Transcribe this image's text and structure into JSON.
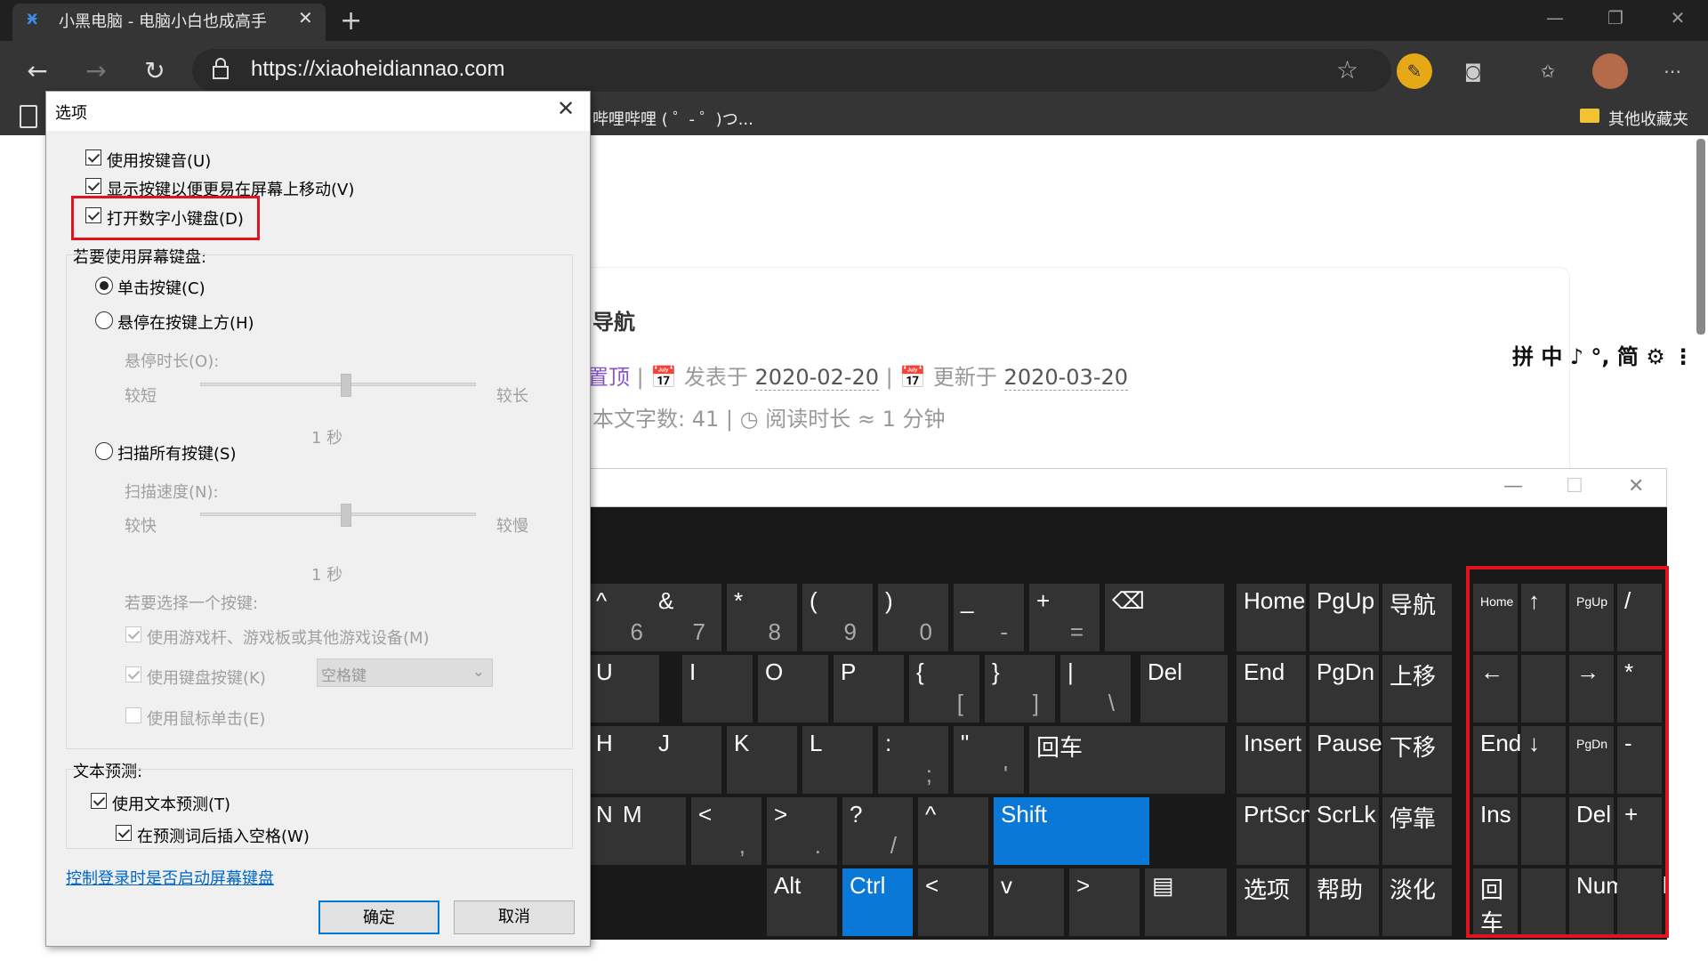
{
  "browser": {
    "tab_title": "小黑电脑 - 电脑小白也成高手",
    "url": "https://xiaoheidiannao.com",
    "bookmark_item": "哔哩哔哩 ( ゜- ゜)つ...",
    "bookmark_other": "其他收藏夹"
  },
  "page": {
    "post_title": "导航",
    "meta_pin": "置顶",
    "meta_published_label": "发表于",
    "meta_published": "2020-02-20",
    "meta_updated_label": "更新于",
    "meta_updated": "2020-03-20",
    "word_count_label": "本文字数:",
    "word_count": "41",
    "read_time": "阅读时长 ≈ 1 分钟",
    "ime_bar": "拼 中 ♪ °, 简 ⚙ ⋮"
  },
  "dialog": {
    "title": "选项",
    "opt_sound": "使用按键音(U)",
    "opt_show_keys": "显示按键以便更易在屏幕上移动(V)",
    "opt_numpad": "打开数字小键盘(D)",
    "use_keyboard_label": "若要使用屏幕键盘:",
    "radio_click": "单击按键(C)",
    "radio_hover": "悬停在按键上方(H)",
    "hover_duration": "悬停时长(O):",
    "short": "较短",
    "long": "较长",
    "one_sec_1": "1 秒",
    "radio_scan": "扫描所有按键(S)",
    "scan_speed": "扫描速度(N):",
    "fast": "较快",
    "slow": "较慢",
    "one_sec_2": "1 秒",
    "select_key_label": "若要选择一个按键:",
    "opt_joystick": "使用游戏杆、游戏板或其他游戏设备(M)",
    "opt_keyboard_key": "使用键盘按键(K)",
    "key_select": "空格键",
    "opt_mouse": "使用鼠标单击(E)",
    "text_predict_label": "文本预测:",
    "opt_text_predict": "使用文本预测(T)",
    "opt_insert_space": "在预测词后插入空格(W)",
    "control_link": "控制登录时是否启动屏幕键盘",
    "ok": "确定",
    "cancel": "取消"
  },
  "osk": {
    "row1": [
      [
        "^",
        "6"
      ],
      [
        "&",
        "7"
      ],
      [
        "*",
        "8"
      ],
      [
        "(",
        "9"
      ],
      [
        ")",
        "0"
      ],
      [
        "_",
        "-"
      ],
      [
        "+",
        "="
      ],
      [
        "⌫",
        ""
      ]
    ],
    "row2": [
      [
        "U",
        ""
      ],
      [
        "I",
        ""
      ],
      [
        "O",
        ""
      ],
      [
        "P",
        ""
      ],
      [
        "{",
        "["
      ],
      [
        "}",
        "]"
      ],
      [
        "|",
        "\\"
      ],
      [
        "Del",
        ""
      ]
    ],
    "row3": [
      [
        "H",
        ""
      ],
      [
        "J",
        ""
      ],
      [
        "K",
        ""
      ],
      [
        "L",
        ""
      ],
      [
        ":",
        ";"
      ],
      [
        "\"",
        "'"
      ],
      [
        "回车",
        ""
      ]
    ],
    "row4": [
      [
        "N",
        ""
      ],
      [
        "M",
        ""
      ],
      [
        "<",
        ","
      ],
      [
        ">",
        "."
      ],
      [
        "?",
        "/"
      ],
      [
        "^",
        ""
      ],
      [
        "Shift",
        ""
      ]
    ],
    "row5": [
      [
        "Alt",
        ""
      ],
      [
        "Ctrl",
        ""
      ],
      [
        "<",
        ""
      ],
      [
        "v",
        ""
      ],
      [
        ">",
        ""
      ],
      [
        "▤",
        ""
      ]
    ],
    "nav": [
      "Home",
      "PgUp",
      "导航",
      "End",
      "PgDn",
      "上移",
      "Insert",
      "Pause",
      "下移",
      "PrtScn",
      "ScrLk",
      "停靠",
      "选项",
      "帮助",
      "淡化"
    ],
    "numpad": [
      "Home",
      "↑",
      "PgUp",
      "/",
      "←",
      "",
      "→",
      "*",
      "End",
      "↓",
      "PgDn",
      "-",
      "Ins",
      "",
      "Del",
      "+",
      "回车",
      "",
      "NumLock",
      ""
    ]
  }
}
